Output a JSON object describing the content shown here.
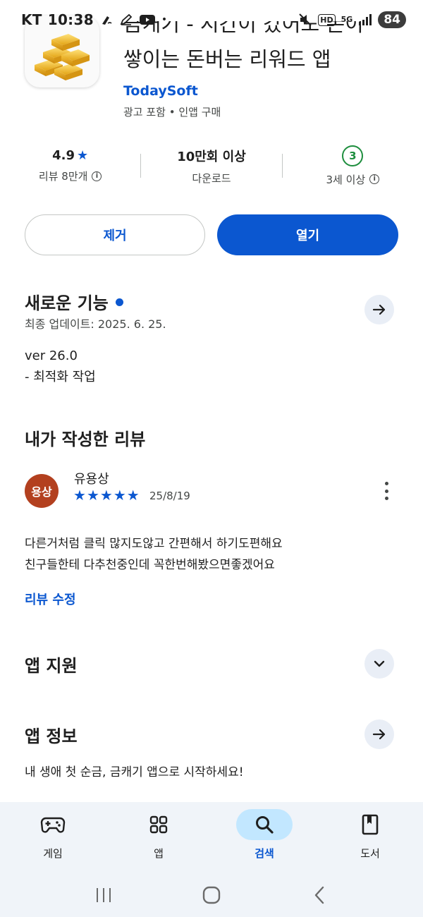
{
  "status_bar": {
    "carrier": "KT",
    "time": "10:38",
    "separator": "•",
    "battery": "84",
    "network": "5G",
    "hd": "HD"
  },
  "app": {
    "title_line1": "금캐기 - 시간이 갔어도 돈이",
    "title_line2": "쌓이는 돈버는 리워드 앱",
    "developer": "TodaySoft",
    "meta": "광고 포함 • 인앱 구매"
  },
  "stats": {
    "rating": "4.9",
    "rating_star": "★",
    "reviews": "리뷰 8만개",
    "downloads": "10만회 이상",
    "downloads_label": "다운로드",
    "age_badge": "3",
    "age_label": "3세 이상",
    "info_glyph": "i"
  },
  "actions": {
    "remove": "제거",
    "open": "열기"
  },
  "whats_new": {
    "title": "새로운 기능",
    "updated": "최종 업데이트: 2025. 6. 25.",
    "version": "ver 26.0",
    "notes": "- 최적화 작업"
  },
  "my_review": {
    "title": "내가 작성한 리뷰",
    "avatar_text": "용상",
    "reviewer": "유용상",
    "stars": 5,
    "star_glyphs": [
      "★",
      "★",
      "★",
      "★",
      "★"
    ],
    "date": "25/8/19",
    "text_line1": "다른거처럼 클릭 많지도않고 간편해서 하기도편해요",
    "text_line2": "친구들한테 다추천중인데 꼭한번해봤으면좋겠어요",
    "edit": "리뷰 수정"
  },
  "app_support": {
    "title": "앱 지원"
  },
  "app_info": {
    "title": "앱 정보",
    "description": "내 생애 첫 순금, 금캐기 앱으로 시작하세요!"
  },
  "bottom_nav": {
    "items": [
      {
        "label": "게임",
        "icon": "gamepad-icon"
      },
      {
        "label": "앱",
        "icon": "apps-grid-icon"
      },
      {
        "label": "검색",
        "icon": "search-icon",
        "active": true
      },
      {
        "label": "도서",
        "icon": "book-icon"
      }
    ]
  },
  "colors": {
    "accent": "#0b57d0",
    "accent_light": "#c2e7ff",
    "avatar_bg": "#b3401f",
    "age_green": "#1e8e3e"
  }
}
